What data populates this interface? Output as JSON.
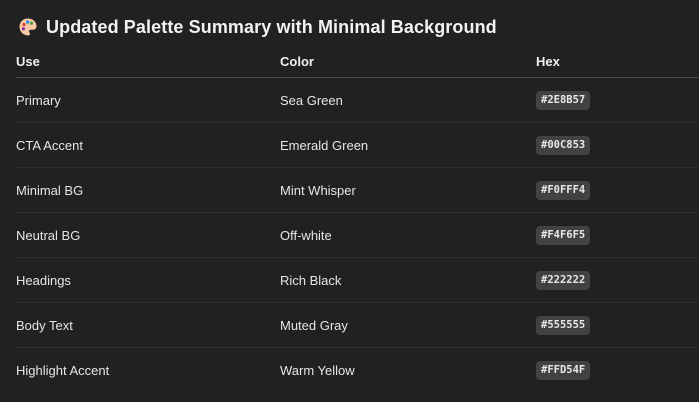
{
  "heading": {
    "icon": "artist-palette-icon",
    "title": "Updated Palette Summary with Minimal Background"
  },
  "table": {
    "columns": [
      "Use",
      "Color",
      "Hex"
    ],
    "rows": [
      {
        "use": "Primary",
        "color": "Sea Green",
        "hex": "#2E8B57"
      },
      {
        "use": "CTA Accent",
        "color": "Emerald Green",
        "hex": "#00C853"
      },
      {
        "use": "Minimal BG",
        "color": "Mint Whisper",
        "hex": "#F0FFF4"
      },
      {
        "use": "Neutral BG",
        "color": "Off-white",
        "hex": "#F4F6F5"
      },
      {
        "use": "Headings",
        "color": "Rich Black",
        "hex": "#222222"
      },
      {
        "use": "Body Text",
        "color": "Muted Gray",
        "hex": "#555555"
      },
      {
        "use": "Highlight Accent",
        "color": "Warm Yellow",
        "hex": "#FFD54F"
      }
    ]
  }
}
